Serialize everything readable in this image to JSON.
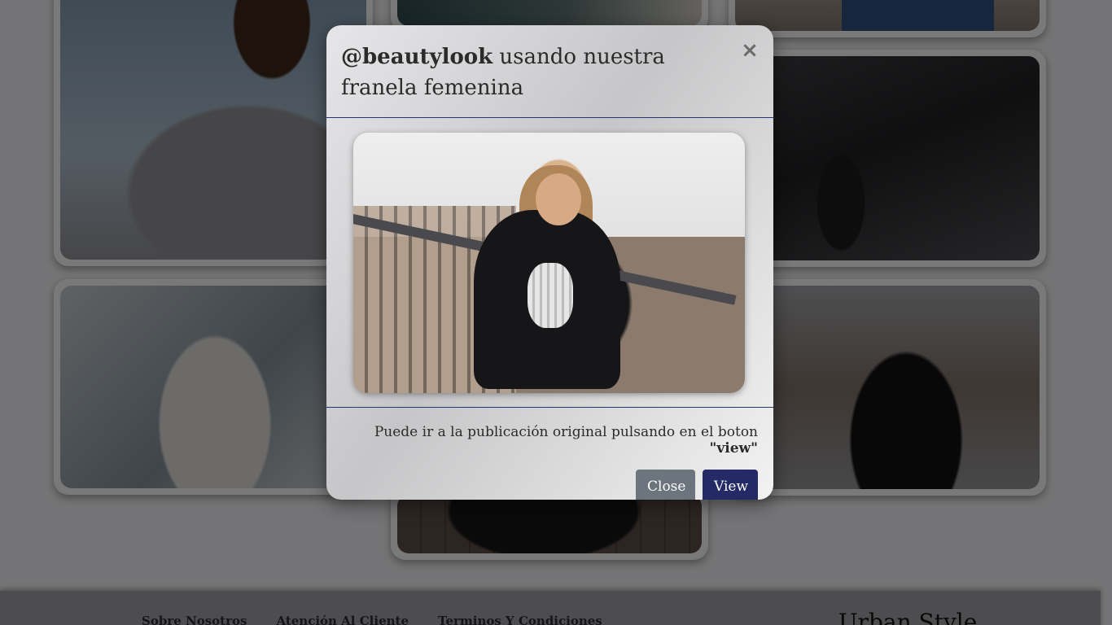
{
  "modal": {
    "handle": "@beautylook",
    "title_rest": " usando nuestra franela femenina",
    "close_glyph": "×",
    "footer_text": "Puede ir a la publicación original pulsando en el boton ",
    "footer_emphasis": "\"view\"",
    "close_label": "Close",
    "view_label": "View"
  },
  "footer": {
    "links": [
      "Sobre Nosotros",
      "Atención Al Cliente",
      "Terminos Y Condiciones"
    ],
    "brand": "Urban Style"
  },
  "colors": {
    "overlay": "rgba(0,0,0,0.5)",
    "modal_divider": "#2c3470",
    "close_button": "#6c757d",
    "view_button": "#232a65"
  }
}
